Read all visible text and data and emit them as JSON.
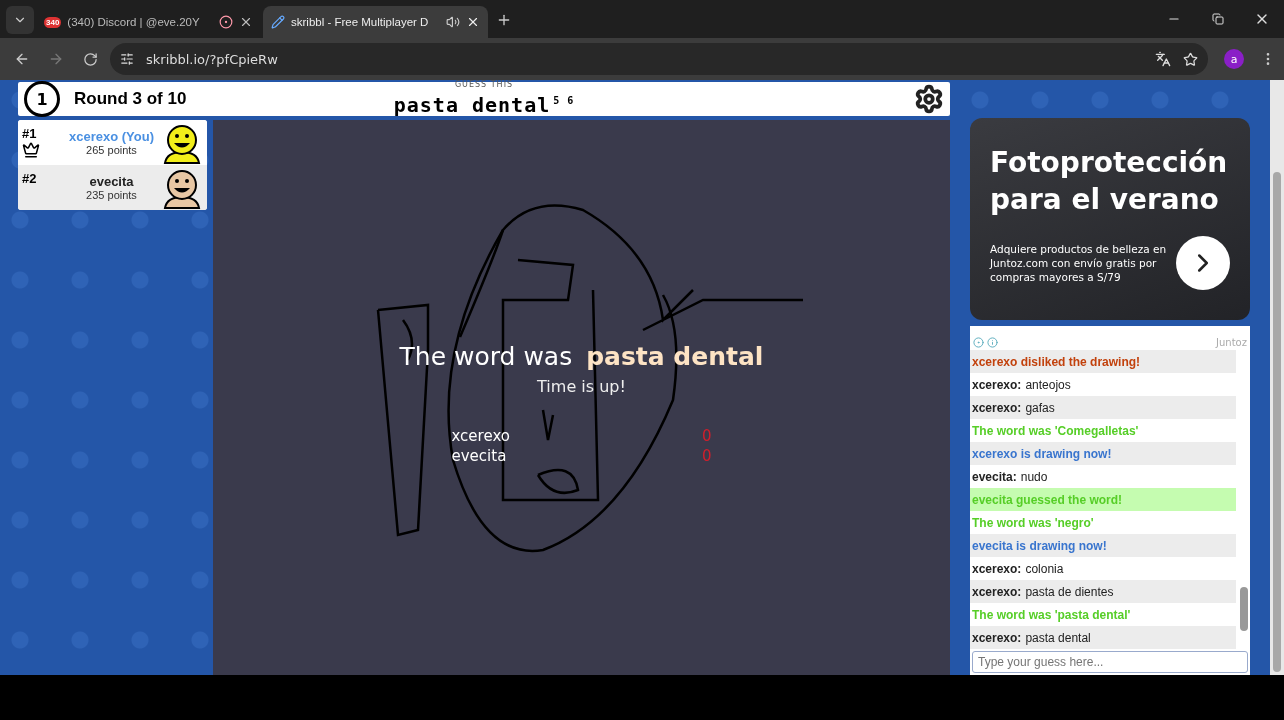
{
  "browser": {
    "tabs": [
      {
        "title": "(340) Discord | @eve.20Y",
        "badge": "340",
        "kind": "recording",
        "selected": false
      },
      {
        "title": "skribbl - Free Multiplayer D",
        "kind": "audio",
        "selected": true
      }
    ],
    "address": "skribbl.io/?pfCpieRw",
    "profile": "a"
  },
  "header": {
    "clock": "1",
    "round": "Round 3 of 10",
    "hint": "GUESS THIS",
    "word": "pasta dental",
    "lengths": "5 6"
  },
  "players": [
    {
      "rank": "#1",
      "name": "xcerexo (You)",
      "you": true,
      "points": "265 points",
      "crown": true,
      "color": "#f2ee1a"
    },
    {
      "rank": "#2",
      "name": "evecita",
      "you": false,
      "points": "235 points",
      "crown": false,
      "color": "#e8c7a4"
    }
  ],
  "result": {
    "lead": "The word was",
    "word": "pasta dental",
    "reason": "Time is up!",
    "scores": [
      {
        "name": "xcerexo",
        "score": "0"
      },
      {
        "name": "evecita",
        "score": "0"
      }
    ]
  },
  "ad": {
    "title": "Fotoprotección para el verano",
    "body": "Adquiere productos de belleza en Juntoz.com con envío gratis por compras mayores a S/79",
    "sponsor": "Juntoz"
  },
  "chat": {
    "messages": [
      {
        "kind": "dislike",
        "text": "xcerexo disliked the drawing!"
      },
      {
        "kind": "guess",
        "name": "xcerexo:",
        "text": "anteojos"
      },
      {
        "kind": "guess",
        "name": "xcerexo:",
        "text": "gafas"
      },
      {
        "kind": "word",
        "text": "The word was 'Comegalletas'"
      },
      {
        "kind": "drawing",
        "text": "xcerexo is drawing now!"
      },
      {
        "kind": "guess",
        "name": "evecita:",
        "text": "nudo"
      },
      {
        "kind": "correct",
        "text": "evecita guessed the word!"
      },
      {
        "kind": "word",
        "text": "The word was 'negro'"
      },
      {
        "kind": "drawing",
        "text": "evecita is drawing now!"
      },
      {
        "kind": "guess",
        "name": "xcerexo:",
        "text": "colonia"
      },
      {
        "kind": "guess",
        "name": "xcerexo:",
        "text": "pasta de dientes"
      },
      {
        "kind": "word",
        "text": "The word was 'pasta dental'"
      },
      {
        "kind": "guess",
        "name": "xcerexo:",
        "text": "pasta dental"
      }
    ],
    "placeholder": "Type your guess here..."
  }
}
